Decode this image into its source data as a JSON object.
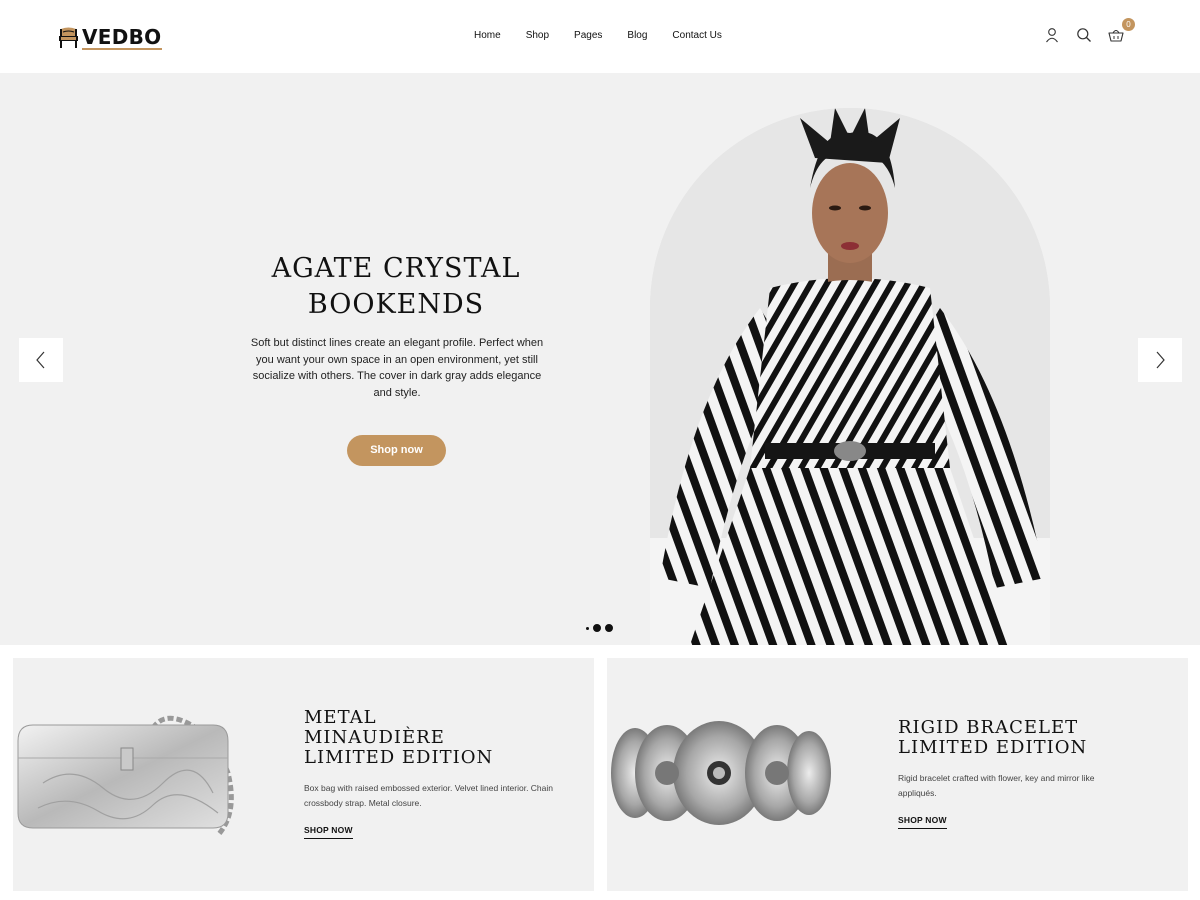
{
  "header": {
    "logo_text": "VEDBO",
    "nav": [
      "Home",
      "Shop",
      "Pages",
      "Blog",
      "Contact Us"
    ],
    "cart_count": "0",
    "icons": [
      "user-icon",
      "search-icon",
      "cart-icon"
    ]
  },
  "hero": {
    "title_line1": "AGATE CRYSTAL",
    "title_line2": "BOOKENDS",
    "description": "Soft but distinct lines create an elegant profile. Perfect when you want your own space in an open environment, yet still socialize with others. The cover in dark gray adds elegance and style.",
    "button_label": "Shop now",
    "image": "woman-striped-dress-photo",
    "slides": 3
  },
  "promos": [
    {
      "title_line1": "METAL",
      "title_line2": "MINAUDIÈRE",
      "title_line3": "LIMITED EDITION",
      "description": "Box bag with raised embossed exterior. Velvet lined interior. Chain crossbody strap. Metal closure.",
      "link": "SHOP NOW",
      "image": "silver-clutch-bag"
    },
    {
      "title_line1": "RIGID BRACELET",
      "title_line2": "LIMITED EDITION",
      "description": "Rigid bracelet crafted with flower, key and mirror like appliqués.",
      "link": "SHOP NOW",
      "image": "silver-bracelet"
    }
  ],
  "colors": {
    "accent": "#c3955f",
    "hero_bg": "#f1f1f1",
    "text": "#111111"
  }
}
